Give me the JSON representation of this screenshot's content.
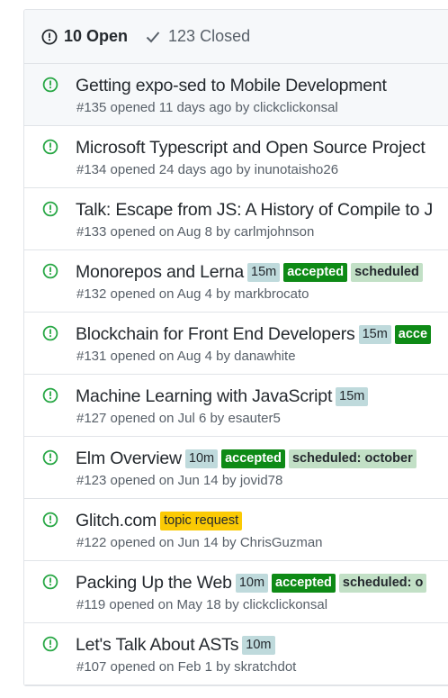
{
  "header": {
    "open_label": "10 Open",
    "closed_label": "123 Closed"
  },
  "colors": {
    "open_icon": "#28a745",
    "accepted_label": "#0e8a16",
    "scheduled_label": "#c2e0c6",
    "time_label": "#bfdadc",
    "topic_label": "#fbca04"
  },
  "issues": [
    {
      "title": "Getting expo-sed to Mobile Development",
      "meta": "#135 opened 11 days ago by clickclickonsal",
      "labels": []
    },
    {
      "title": "Microsoft Typescript and Open Source Project",
      "meta": "#134 opened 24 days ago by inunotaisho26",
      "labels": []
    },
    {
      "title": "Talk: Escape from JS: A History of Compile to J",
      "meta": "#133 opened on Aug 8 by carlmjohnson",
      "labels": []
    },
    {
      "title": "Monorepos and Lerna",
      "meta": "#132 opened on Aug 4 by markbrocato",
      "labels": [
        "15m",
        "accepted",
        "scheduled"
      ]
    },
    {
      "title": "Blockchain for Front End Developers",
      "meta": "#131 opened on Aug 4 by danawhite",
      "labels": [
        "15m",
        "acce"
      ]
    },
    {
      "title": "Machine Learning with JavaScript",
      "meta": "#127 opened on Jul 6 by esauter5",
      "labels": [
        "15m"
      ]
    },
    {
      "title": "Elm Overview",
      "meta": "#123 opened on Jun 14 by jovid78",
      "labels": [
        "10m",
        "accepted",
        "scheduled: october"
      ]
    },
    {
      "title": "Glitch.com",
      "meta": "#122 opened on Jun 14 by ChrisGuzman",
      "labels": [
        "topic request"
      ]
    },
    {
      "title": "Packing Up the Web",
      "meta": "#119 opened on May 18 by clickclickonsal",
      "labels": [
        "10m",
        "accepted",
        "scheduled: o"
      ]
    },
    {
      "title": "Let's Talk About ASTs",
      "meta": "#107 opened on Feb 1 by skratchdot",
      "labels": [
        "10m"
      ]
    }
  ]
}
